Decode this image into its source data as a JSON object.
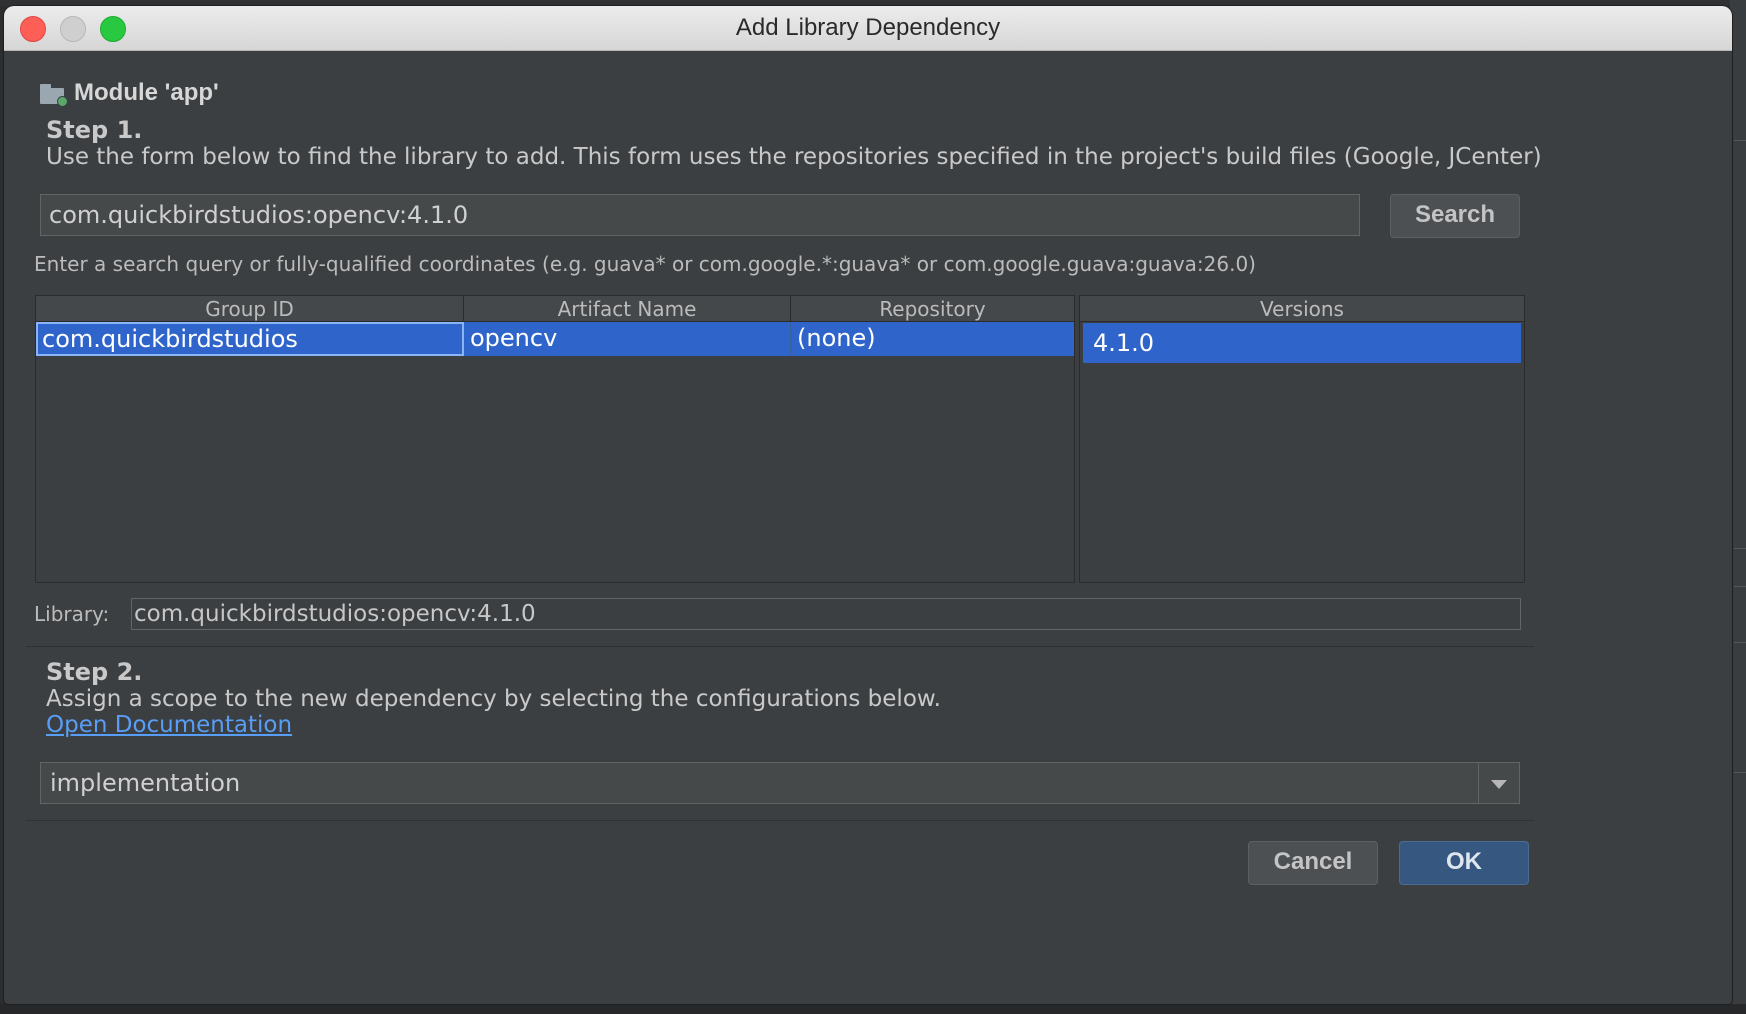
{
  "window": {
    "title": "Add Library Dependency"
  },
  "module": {
    "label": "Module 'app'"
  },
  "step1": {
    "title": "Step 1.",
    "description": "Use the form below to find the library to add. This form uses the repositories specified in the project's build files (Google, JCenter)",
    "search_value": "com.quickbirdstudios:opencv:4.1.0",
    "search_button": "Search",
    "hint": "Enter a search query or fully-qualified coordinates (e.g. guava* or com.google.*:guava* or com.google.guava:guava:26.0)"
  },
  "results": {
    "headers": [
      "Group ID",
      "Artifact Name",
      "Repository"
    ],
    "rows": [
      {
        "group_id": "com.quickbirdstudios",
        "artifact": "opencv",
        "repository": "(none)"
      }
    ]
  },
  "versions": {
    "header": "Versions",
    "items": [
      "4.1.0"
    ]
  },
  "library": {
    "label": "Library:",
    "value": "com.quickbirdstudios:opencv:4.1.0"
  },
  "step2": {
    "title": "Step 2.",
    "description": "Assign a scope to the new dependency by selecting the configurations below.",
    "doc_link": "Open Documentation",
    "scope_value": "implementation"
  },
  "footer": {
    "cancel": "Cancel",
    "ok": "OK"
  },
  "colors": {
    "selection": "#2f65ca",
    "link": "#589df6",
    "close": "#fd5f57",
    "maximize": "#28c940"
  }
}
